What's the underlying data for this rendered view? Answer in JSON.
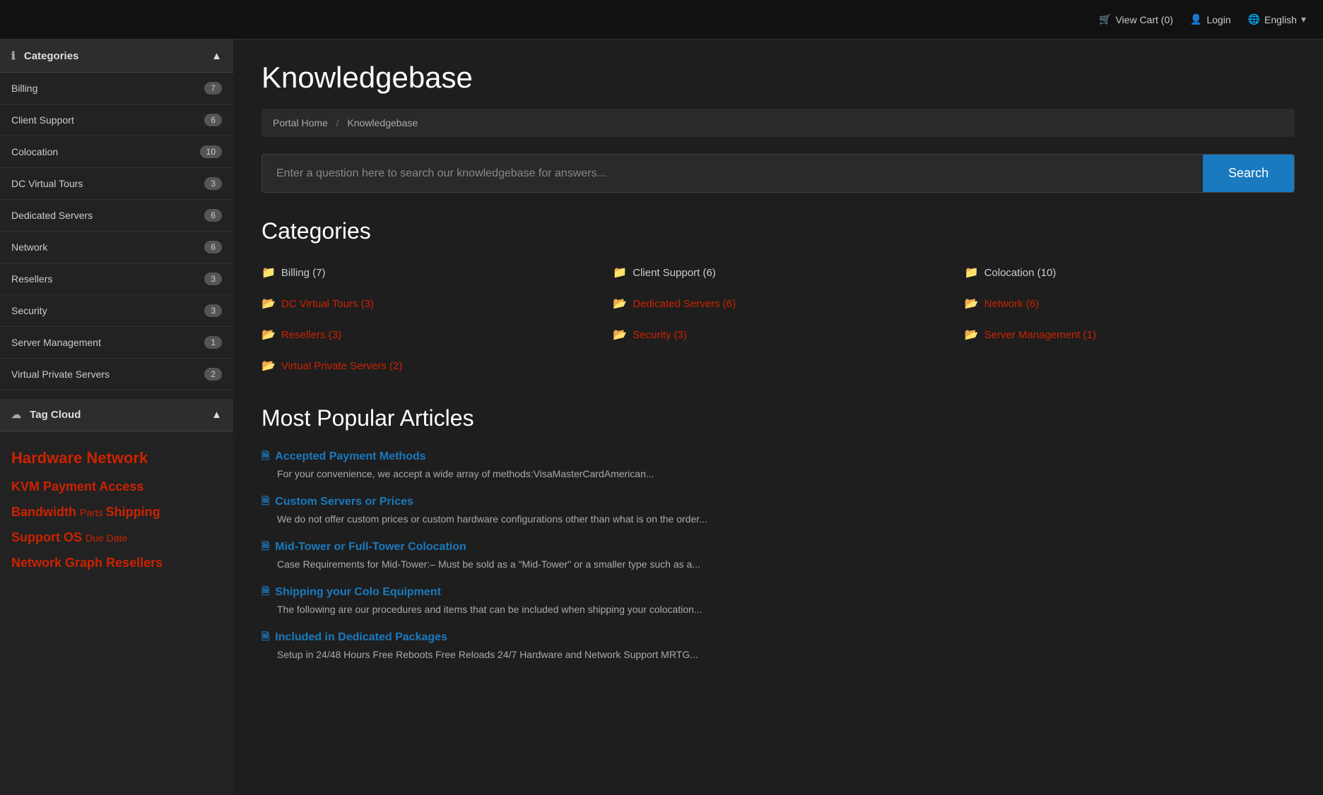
{
  "topnav": {
    "cart_label": "View Cart (0)",
    "login_label": "Login",
    "language_label": "English"
  },
  "sidebar": {
    "categories_header": "Categories",
    "items": [
      {
        "label": "Billing",
        "count": "7"
      },
      {
        "label": "Client Support",
        "count": "6"
      },
      {
        "label": "Colocation",
        "count": "10"
      },
      {
        "label": "DC Virtual Tours",
        "count": "3"
      },
      {
        "label": "Dedicated Servers",
        "count": "6"
      },
      {
        "label": "Network",
        "count": "6"
      },
      {
        "label": "Resellers",
        "count": "3"
      },
      {
        "label": "Security",
        "count": "3"
      },
      {
        "label": "Server Management",
        "count": "1"
      },
      {
        "label": "Virtual Private Servers",
        "count": "2"
      }
    ],
    "tagcloud_header": "Tag Cloud",
    "tags": [
      {
        "label": "Hardware",
        "size": "large"
      },
      {
        "label": "Network",
        "size": "large"
      },
      {
        "label": "KVM",
        "size": "medium"
      },
      {
        "label": "Payment",
        "size": "medium"
      },
      {
        "label": "Access",
        "size": "medium"
      },
      {
        "label": "Bandwidth",
        "size": "medium"
      },
      {
        "label": "Parts",
        "size": "small"
      },
      {
        "label": "Shipping",
        "size": "medium"
      },
      {
        "label": "Support",
        "size": "medium"
      },
      {
        "label": "OS",
        "size": "medium"
      },
      {
        "label": "Due",
        "size": "small"
      },
      {
        "label": "Date",
        "size": "small"
      },
      {
        "label": "Network",
        "size": "medium"
      },
      {
        "label": "Graph",
        "size": "medium"
      },
      {
        "label": "Resellers",
        "size": "medium"
      }
    ]
  },
  "main": {
    "page_title": "Knowledgebase",
    "breadcrumb_home": "Portal Home",
    "breadcrumb_current": "Knowledgebase",
    "search_placeholder": "Enter a question here to search our knowledgebase for answers...",
    "search_button": "Search",
    "categories_title": "Categories",
    "categories": [
      {
        "label": "Billing (7)",
        "type": "plain"
      },
      {
        "label": "Client Support (6)",
        "type": "plain"
      },
      {
        "label": "Colocation (10)",
        "type": "plain"
      },
      {
        "label": "DC Virtual Tours (3)",
        "type": "red"
      },
      {
        "label": "Dedicated Servers (6)",
        "type": "red"
      },
      {
        "label": "Network (6)",
        "type": "red"
      },
      {
        "label": "Resellers (3)",
        "type": "red"
      },
      {
        "label": "Security (3)",
        "type": "red"
      },
      {
        "label": "Server Management (1)",
        "type": "red"
      },
      {
        "label": "Virtual Private Servers (2)",
        "type": "red"
      }
    ],
    "popular_title": "Most Popular Articles",
    "articles": [
      {
        "title": "Accepted Payment Methods",
        "excerpt": "For your convenience, we accept a wide array of methods:VisaMasterCardAmerican..."
      },
      {
        "title": "Custom Servers or Prices",
        "excerpt": "We do not offer custom prices or custom hardware configurations other than what is on the order..."
      },
      {
        "title": "Mid-Tower or Full-Tower Colocation",
        "excerpt": "Case Requirements for Mid-Tower:– Must be sold as a \"Mid-Tower\" or a smaller type such as a..."
      },
      {
        "title": "Shipping your Colo Equipment",
        "excerpt": "The following are our procedures and items that can be included when shipping your colocation..."
      },
      {
        "title": "Included in Dedicated Packages",
        "excerpt": "Setup in 24/48 Hours Free Reboots Free Reloads 24/7 Hardware and Network Support MRTG..."
      }
    ]
  }
}
